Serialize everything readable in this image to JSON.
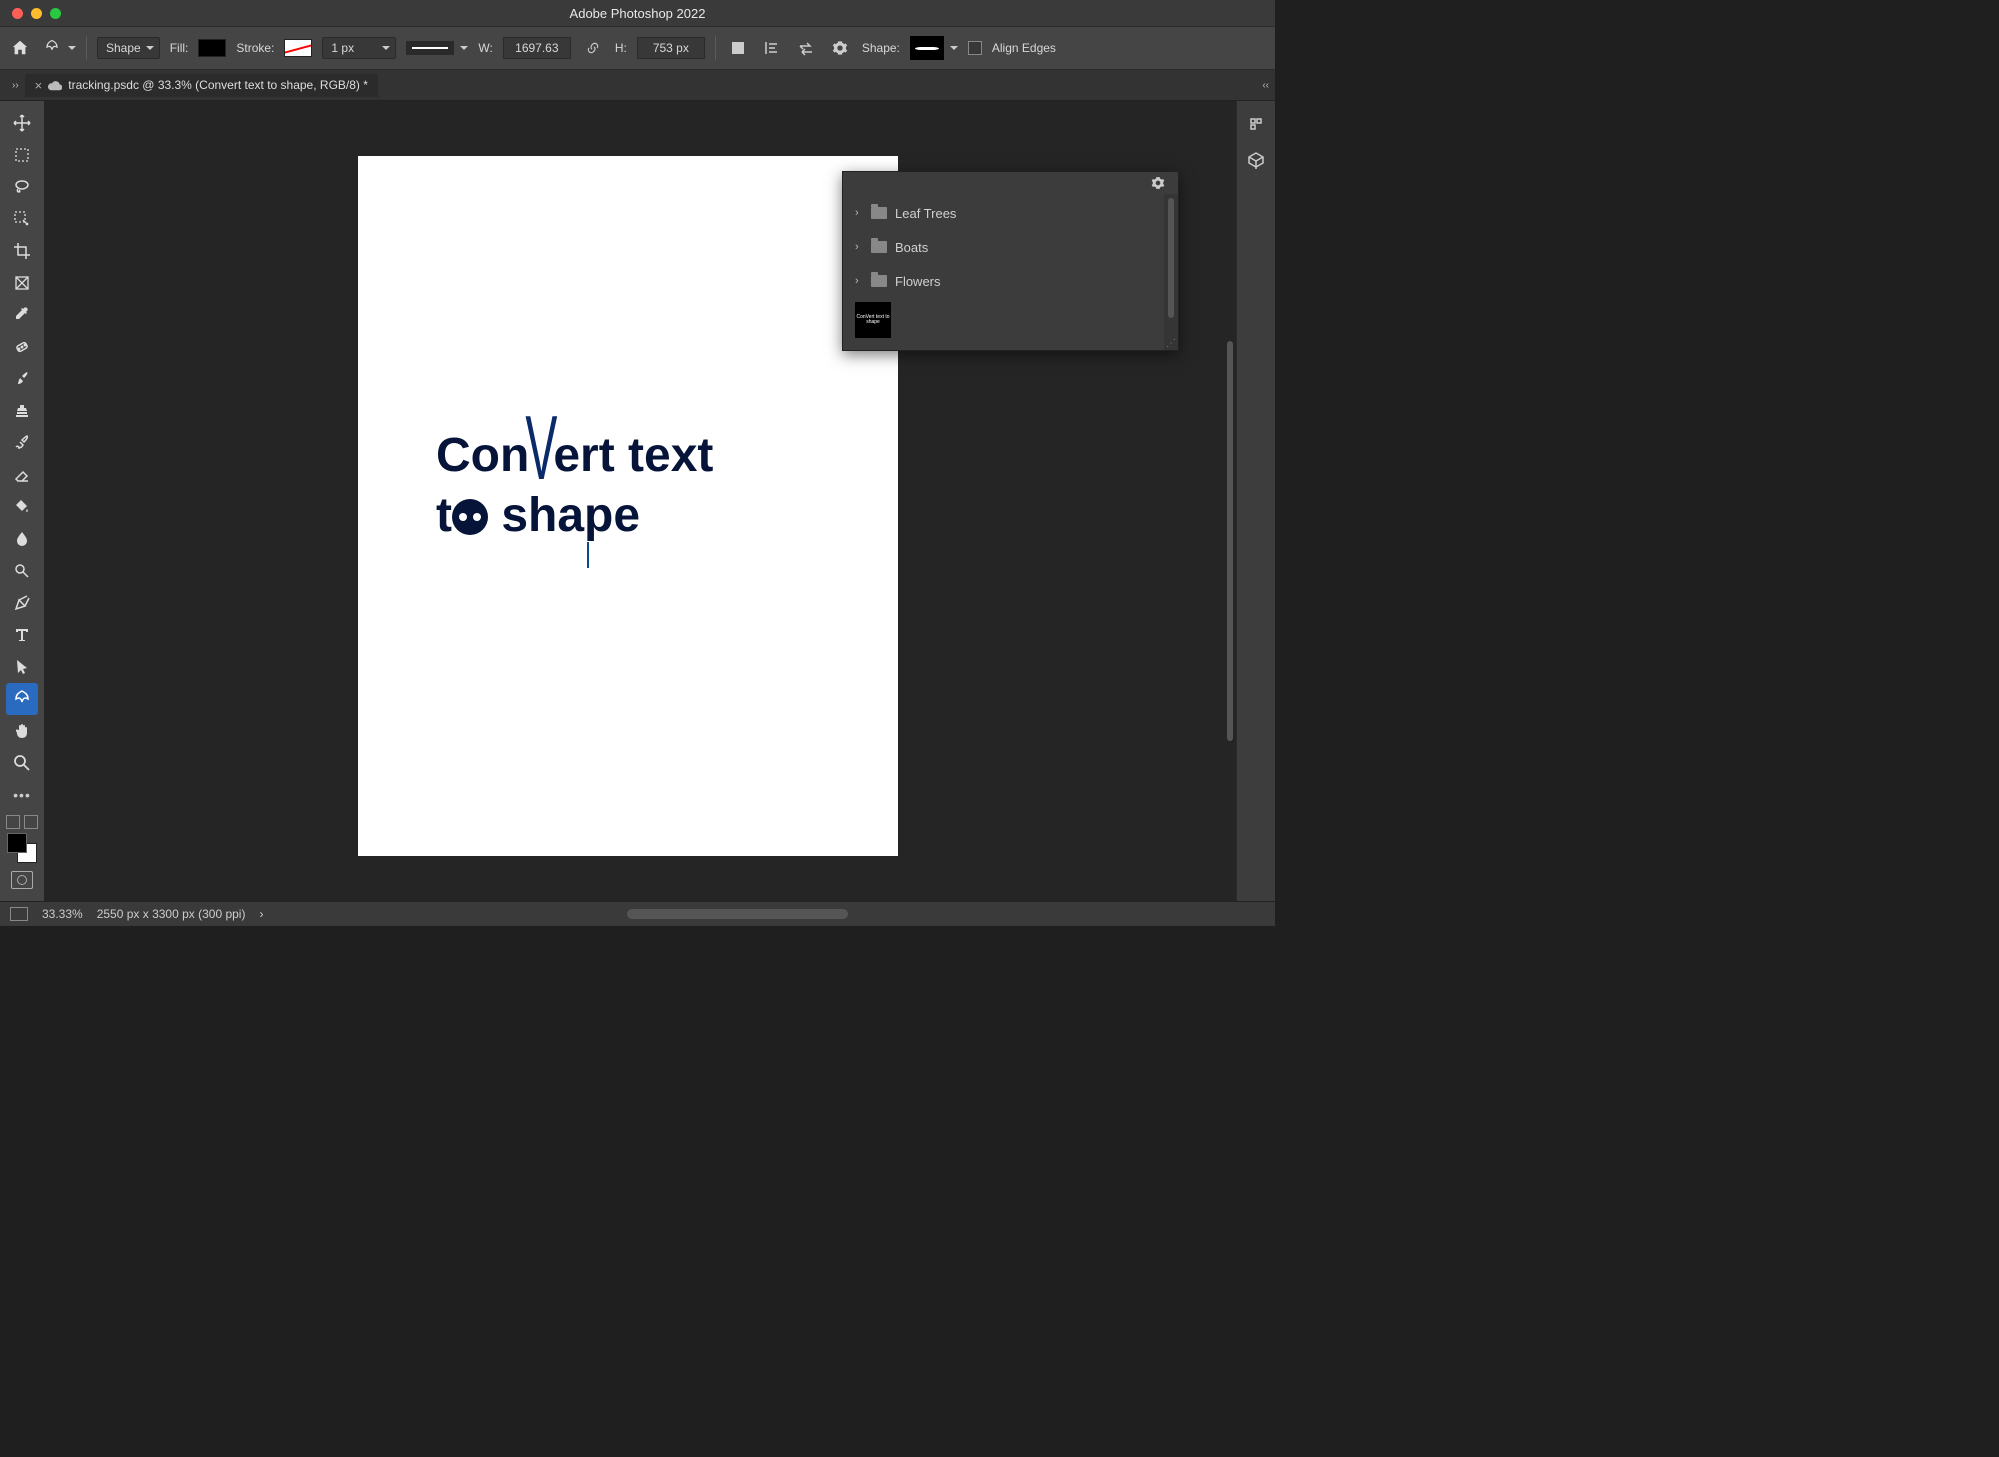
{
  "app_title": "Adobe Photoshop 2022",
  "options": {
    "mode_label": "Shape",
    "fill_label": "Fill:",
    "stroke_label": "Stroke:",
    "stroke_width_value": "1 px",
    "w_label": "W:",
    "w_value": "1697.63",
    "h_label": "H:",
    "h_value": "753 px",
    "shape_label": "Shape:",
    "align_edges_label": "Align Edges"
  },
  "tab": {
    "title": "tracking.psdc @ 33.3% (Convert text to shape, RGB/8) *"
  },
  "popover": {
    "items": [
      "Leaf Trees",
      "Boats",
      "Flowers"
    ],
    "thumb_caption": "ConVert text to shape"
  },
  "canvas": {
    "line1_pre": "Con",
    "line1_v": "V",
    "line1_post": "ert text",
    "line2_pre": "t",
    "line2_post": " sha",
    "line2_p": "p",
    "line2_end": "e"
  },
  "status": {
    "zoom": "33.33%",
    "dims": "2550 px x 3300 px (300 ppi)"
  },
  "tools": [
    "move-tool",
    "marquee-tool",
    "lasso-tool",
    "quick-select-tool",
    "crop-tool",
    "frame-tool",
    "eyedropper-tool",
    "healing-tool",
    "brush-tool",
    "clone-tool",
    "history-brush-tool",
    "eraser-tool",
    "paint-bucket-tool",
    "blur-tool",
    "dodge-tool",
    "pen-tool",
    "type-tool",
    "path-select-tool",
    "custom-shape-tool",
    "hand-tool",
    "zoom-tool"
  ]
}
